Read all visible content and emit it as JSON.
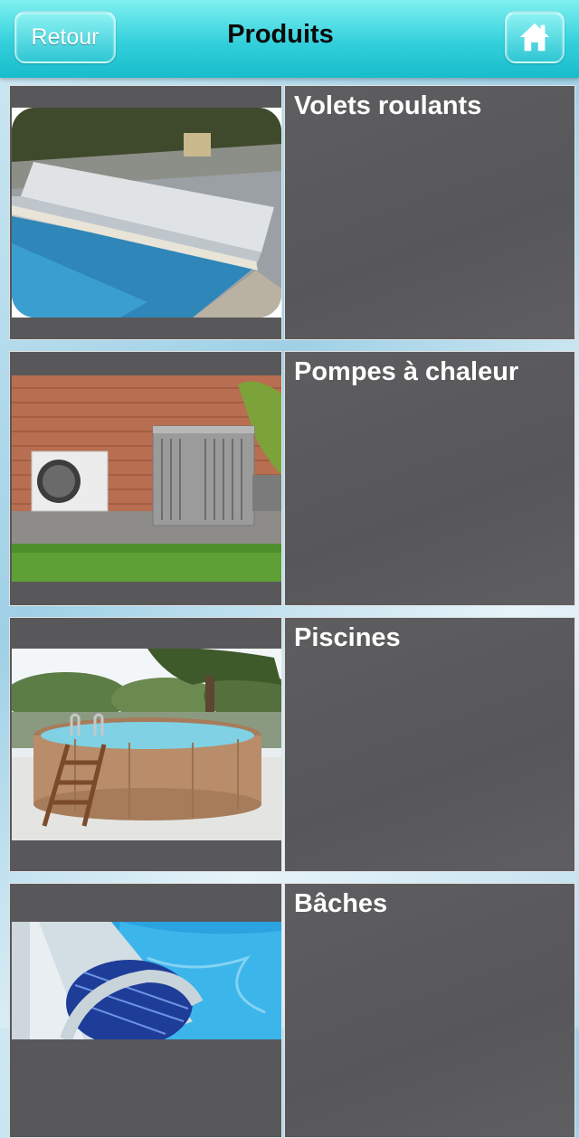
{
  "header": {
    "back_label": "Retour",
    "title": "Produits",
    "home_icon": "home-icon"
  },
  "products": [
    {
      "label": "Volets roulants"
    },
    {
      "label": "Pompes à chaleur"
    },
    {
      "label": "Piscines"
    },
    {
      "label": "Bâches"
    }
  ],
  "colors": {
    "header_accent": "#33d0dc",
    "panel_bg": "#5b5b5d",
    "label_text": "#ffffff"
  }
}
